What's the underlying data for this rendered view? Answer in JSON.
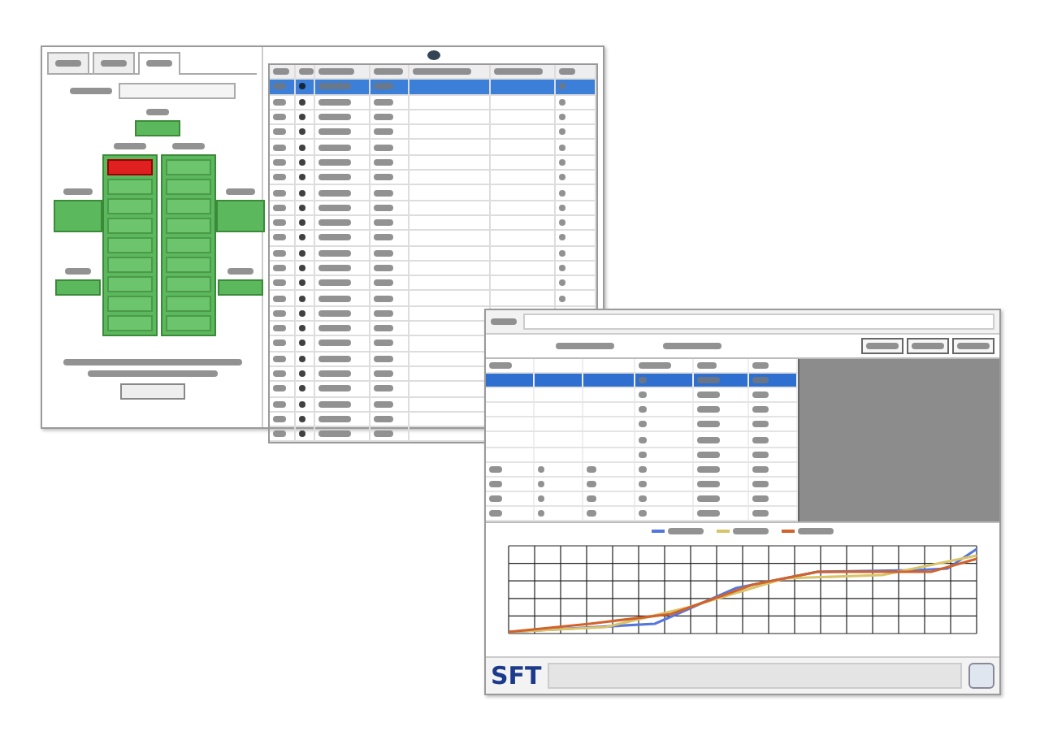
{
  "seat_window": {
    "tabs": [
      {
        "selected": false
      },
      {
        "selected": false
      },
      {
        "selected": true
      }
    ],
    "seat_columns": [
      {
        "cells": [
          {
            "alert": true
          },
          {
            "alert": false
          },
          {
            "alert": false
          },
          {
            "alert": false
          },
          {
            "alert": false
          },
          {
            "alert": false
          },
          {
            "alert": false
          },
          {
            "alert": false
          },
          {
            "alert": false
          }
        ]
      },
      {
        "cells": [
          {
            "alert": false
          },
          {
            "alert": false
          },
          {
            "alert": false
          },
          {
            "alert": false
          },
          {
            "alert": false
          },
          {
            "alert": false
          },
          {
            "alert": false
          },
          {
            "alert": false
          },
          {
            "alert": false
          }
        ]
      }
    ],
    "table_rows": [
      {
        "selected": true
      },
      {
        "selected": false
      },
      {
        "selected": false
      },
      {
        "selected": false
      },
      {
        "selected": false
      },
      {
        "selected": false
      },
      {
        "selected": false
      },
      {
        "selected": false
      },
      {
        "selected": false
      },
      {
        "selected": false
      },
      {
        "selected": false
      },
      {
        "selected": false
      },
      {
        "selected": false
      },
      {
        "selected": false
      },
      {
        "selected": false
      },
      {
        "selected": false
      },
      {
        "selected": false
      },
      {
        "selected": false
      },
      {
        "selected": false
      },
      {
        "selected": false
      },
      {
        "selected": false
      },
      {
        "selected": false
      },
      {
        "selected": false
      },
      {
        "selected": false
      }
    ]
  },
  "chart_window": {
    "table_rows": [
      {
        "selected": true
      },
      {
        "selected": false
      },
      {
        "selected": false
      },
      {
        "selected": false
      },
      {
        "selected": false
      },
      {
        "selected": false
      },
      {
        "selected": false
      },
      {
        "selected": false
      },
      {
        "selected": false
      },
      {
        "selected": false
      }
    ],
    "legend": [
      {
        "color": "#5577dd"
      },
      {
        "color": "#d9c46a"
      },
      {
        "color": "#d2622c"
      }
    ],
    "logo": "SFT"
  }
}
